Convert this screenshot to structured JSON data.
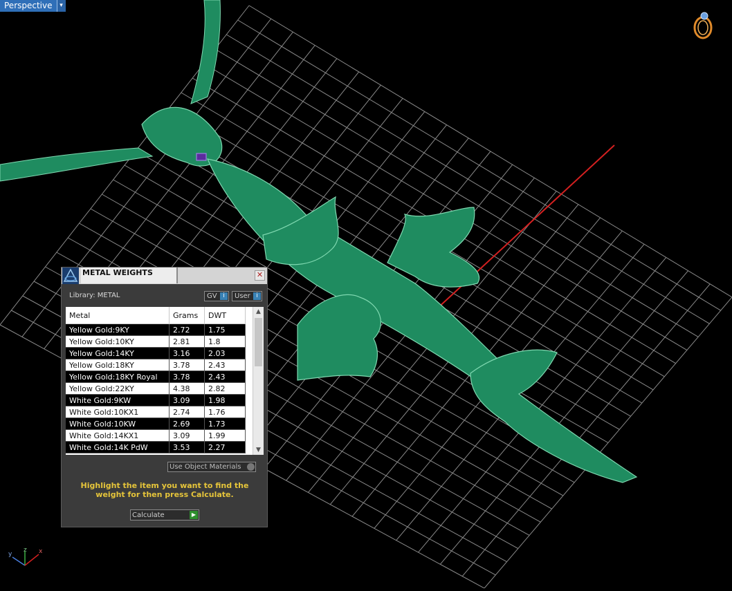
{
  "viewport": {
    "view_label": "Perspective",
    "dropdown_glyph": "▾",
    "ring_icon": "ring-icon",
    "axis_labels": {
      "y": "y",
      "z": "z",
      "x": "x"
    }
  },
  "dialog": {
    "title": "METAL WEIGHTS",
    "close_glyph": "✕",
    "library_label": "Library: METAL",
    "gv_label": "GV",
    "user_label": "User",
    "columns": [
      "Metal",
      "Grams",
      "DWT"
    ],
    "rows": [
      {
        "metal": "Yellow Gold:9KY",
        "grams": "2.72",
        "dwt": "1.75"
      },
      {
        "metal": "Yellow Gold:10KY",
        "grams": "2.81",
        "dwt": "1.8"
      },
      {
        "metal": "Yellow Gold:14KY",
        "grams": "3.16",
        "dwt": "2.03"
      },
      {
        "metal": "Yellow Gold:18KY",
        "grams": "3.78",
        "dwt": "2.43"
      },
      {
        "metal": "Yellow Gold:18KY Royal",
        "grams": "3.78",
        "dwt": "2.43"
      },
      {
        "metal": "Yellow Gold:22KY",
        "grams": "4.38",
        "dwt": "2.82"
      },
      {
        "metal": "White Gold:9KW",
        "grams": "3.09",
        "dwt": "1.98"
      },
      {
        "metal": "White Gold:10KX1",
        "grams": "2.74",
        "dwt": "1.76"
      },
      {
        "metal": "White Gold:10KW",
        "grams": "2.69",
        "dwt": "1.73"
      },
      {
        "metal": "White Gold:14KX1",
        "grams": "3.09",
        "dwt": "1.99"
      },
      {
        "metal": "White Gold:14K PdW",
        "grams": "3.53",
        "dwt": "2.27"
      }
    ],
    "use_object_materials": "Use Object Materials",
    "hint": "Highlight the item you want to find the weight for then press Calculate.",
    "calculate_label": "Calculate",
    "colors": {
      "hint": "#e6c53a",
      "selected_row": "#000000",
      "pendant": "#1f8c60"
    }
  }
}
